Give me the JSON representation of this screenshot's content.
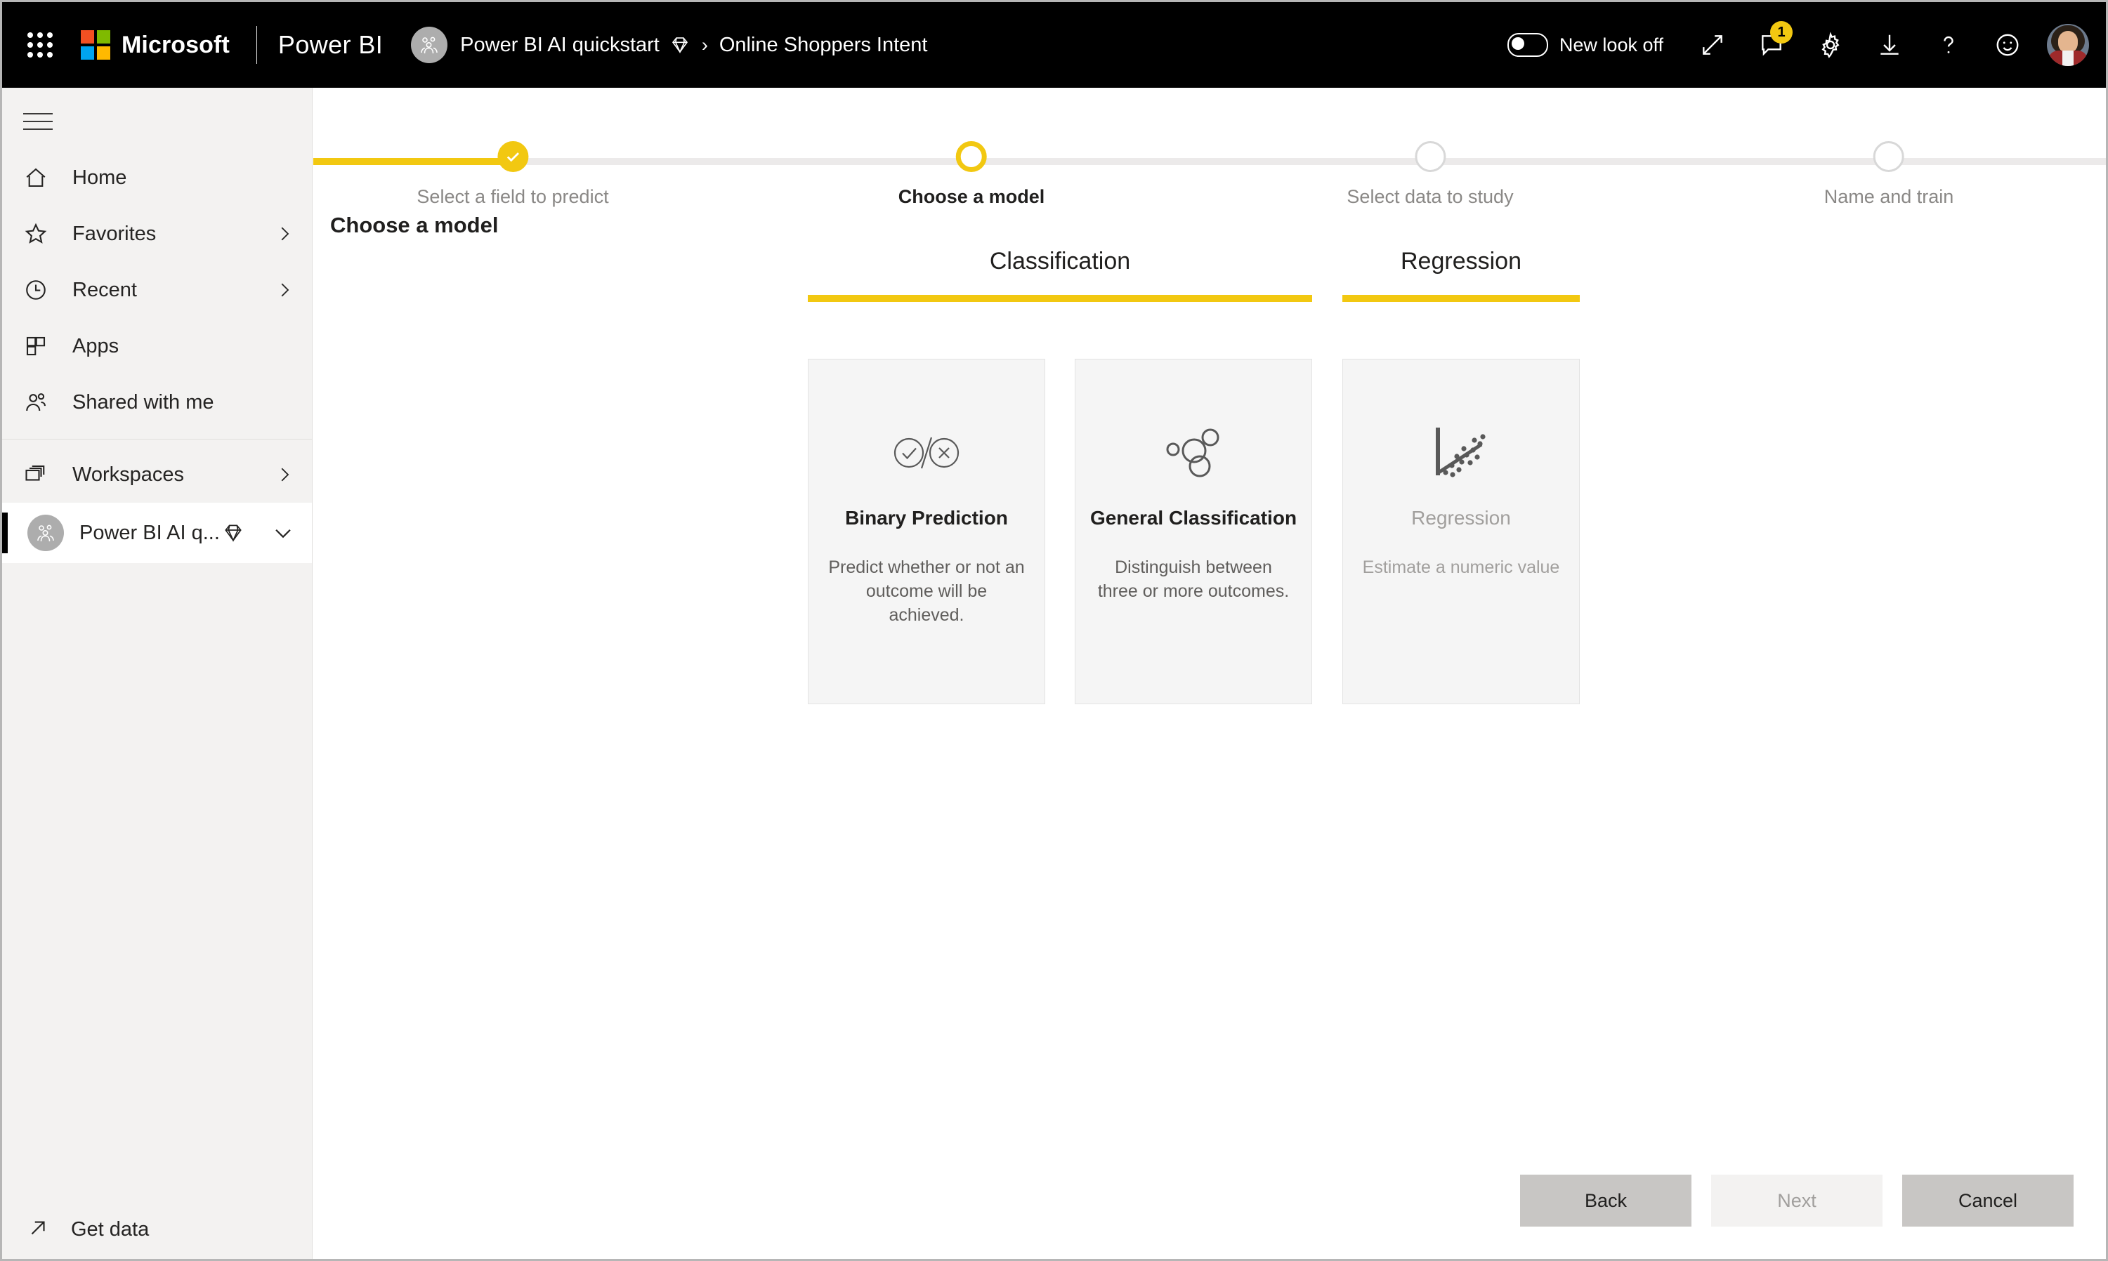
{
  "topbar": {
    "waffle_label": "app-launcher",
    "brand": "Microsoft",
    "product": "Power BI",
    "breadcrumb": {
      "workspace": "Power BI AI quickstart",
      "separator": "›",
      "item": "Online Shoppers Intent"
    },
    "new_look_toggle": "New look off",
    "notification_count": "1",
    "icons": {
      "expand": "expand-icon",
      "notifications": "notifications-icon",
      "settings": "gear-icon",
      "download": "download-icon",
      "help": "help-icon",
      "feedback": "smiley-icon",
      "account": "user-avatar"
    }
  },
  "sidebar": {
    "collapse_label": "nav-collapse",
    "items": [
      {
        "label": "Home",
        "icon": "home-icon",
        "chevron": false
      },
      {
        "label": "Favorites",
        "icon": "star-icon",
        "chevron": true
      },
      {
        "label": "Recent",
        "icon": "clock-icon",
        "chevron": true
      },
      {
        "label": "Apps",
        "icon": "apps-icon",
        "chevron": false
      },
      {
        "label": "Shared with me",
        "icon": "shared-people-icon",
        "chevron": false
      }
    ],
    "workspaces_label": "Workspaces",
    "current_workspace": "Power BI AI q...",
    "get_data": "Get data"
  },
  "wizard": {
    "page_title": "Choose a model",
    "steps": [
      {
        "label": "Select a field to predict",
        "state": "done"
      },
      {
        "label": "Choose a model",
        "state": "current"
      },
      {
        "label": "Select data to study",
        "state": "pending"
      },
      {
        "label": "Name and train",
        "state": "pending"
      }
    ],
    "groups": [
      {
        "name": "Classification"
      },
      {
        "name": "Regression"
      }
    ],
    "models": [
      {
        "title": "Binary Prediction",
        "description": "Predict whether or not an outcome will be achieved.",
        "icon": "binary-check-cross-icon",
        "disabled": false
      },
      {
        "title": "General Classification",
        "description": "Distinguish between three or more outcomes.",
        "icon": "cluster-bubbles-icon",
        "disabled": false
      },
      {
        "title": "Regression",
        "description": "Estimate a numeric value",
        "icon": "scatter-trend-icon",
        "disabled": true
      }
    ],
    "buttons": {
      "back": "Back",
      "next": "Next",
      "cancel": "Cancel"
    }
  },
  "colors": {
    "accent": "#f2c811",
    "topbar_bg": "#000000",
    "sidebar_bg": "#f3f2f1",
    "card_bg": "#f5f5f5"
  }
}
